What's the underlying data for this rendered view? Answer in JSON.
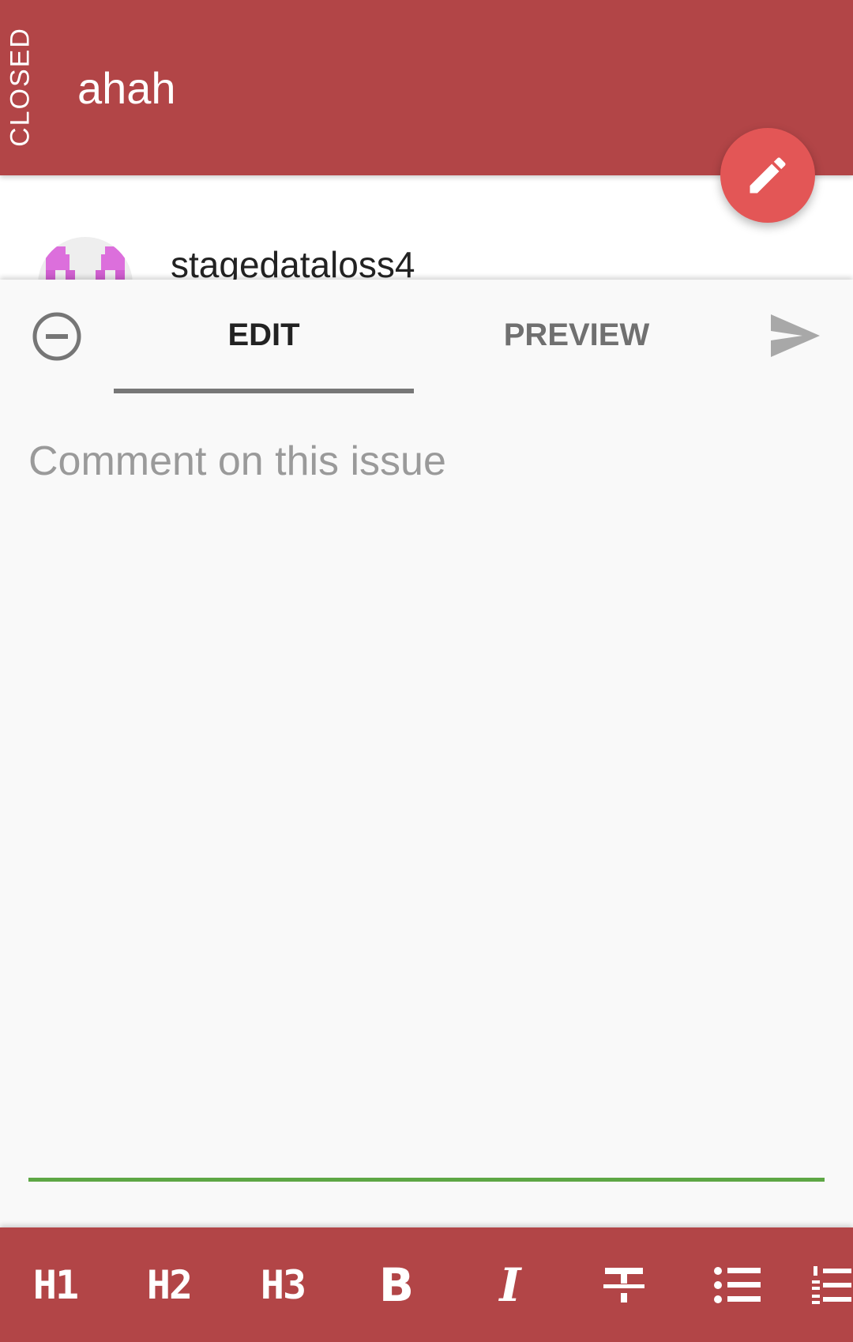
{
  "header": {
    "state": "CLOSED",
    "title": "ahah"
  },
  "fab": {
    "icon": "pencil-icon"
  },
  "issue": {
    "author": "stagedataloss4"
  },
  "editor": {
    "tabs": [
      {
        "label": "EDIT",
        "selected": true
      },
      {
        "label": "PREVIEW",
        "selected": false
      }
    ],
    "comment_placeholder": "Comment on this issue",
    "comment_value": ""
  },
  "toolbar": {
    "h1": "H1",
    "h2": "H2",
    "h3": "H3",
    "bold": "B",
    "italic": "I",
    "strikethrough": "strikethrough-icon",
    "bullet_list": "bullet-list-icon",
    "numbered_list": "numbered-list-icon"
  },
  "colors": {
    "primary": "#b24547",
    "fab": "#e35656",
    "input_underline": "#5ea745",
    "background": "#f9f9f9"
  }
}
